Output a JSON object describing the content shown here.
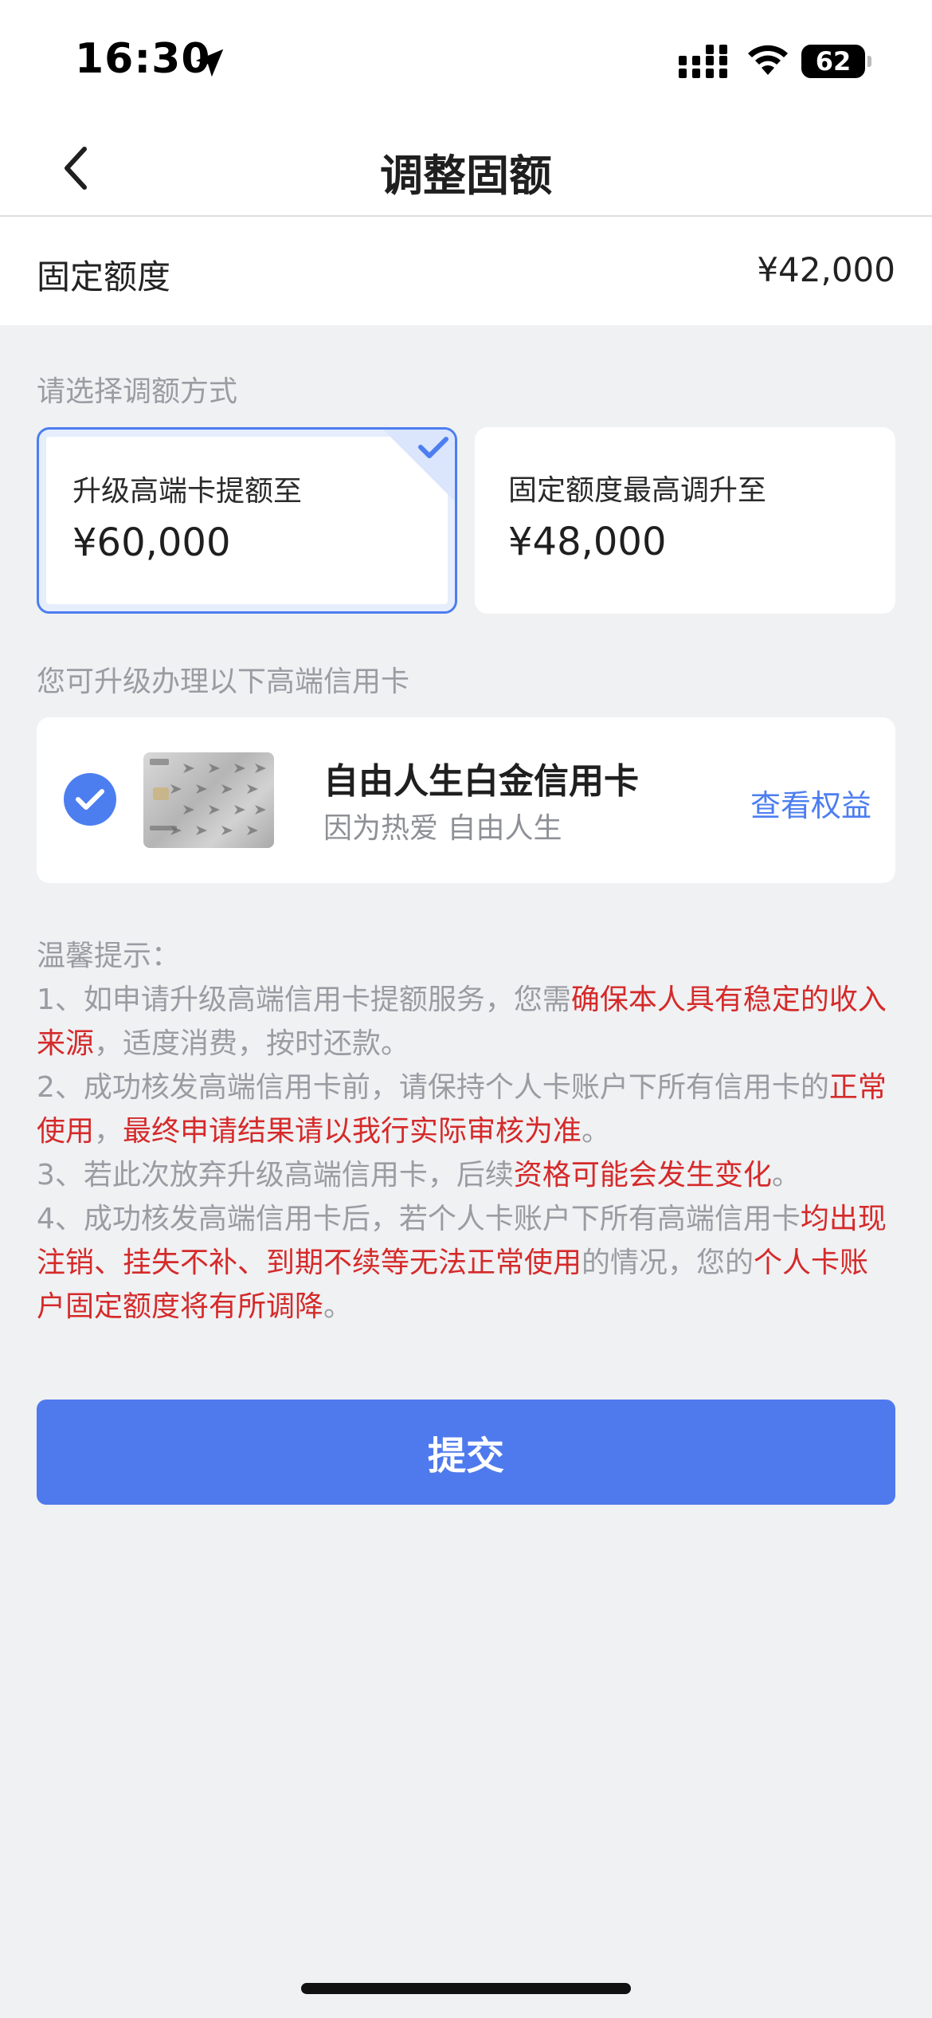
{
  "status_bar": {
    "time": "16:30",
    "battery": "62",
    "icons": [
      "location-arrow-icon",
      "signal-icon",
      "wifi-icon",
      "battery-icon"
    ]
  },
  "nav": {
    "title": "调整固额",
    "back_icon": "chevron-left-icon"
  },
  "quota": {
    "label": "固定额度",
    "value": "¥42,000"
  },
  "adjust_section": {
    "label": "请选择调额方式",
    "options": [
      {
        "title": "升级高端卡提额至",
        "value": "¥60,000",
        "selected": true
      },
      {
        "title": "固定额度最高调升至",
        "value": "¥48,000",
        "selected": false
      }
    ]
  },
  "upgrade_section": {
    "label": "您可升级办理以下高端信用卡",
    "card": {
      "name": "自由人生白金信用卡",
      "slogan": "因为热爱 自由人生",
      "link": "查看权益",
      "selected": true
    }
  },
  "tips": {
    "title": "温馨提示：",
    "items": [
      {
        "p1": "1、如申请升级高端信用卡提额服务，您需",
        "h1": "确保本人具有稳定的收入来源",
        "p2": "，适度消费，按时还款。"
      },
      {
        "p1": "2、成功核发高端信用卡前，请保持个人卡账户下所有信用卡的",
        "h1": "正常使用",
        "p2": "，",
        "h2": "最终申请结果请以我行实际审核为准",
        "p3": "。"
      },
      {
        "p1": "3、若此次放弃升级高端信用卡，后续",
        "h1": "资格可能会发生变化",
        "p2": "。"
      },
      {
        "p1": "4、成功核发高端信用卡后，若个人卡账户下所有高端信用卡",
        "h1": "均出现注销、挂失不补、到期不续等无法正常使用",
        "p2": "的情况，您的",
        "h2": "个人卡账户固定额度将有所调降",
        "p3": "。"
      }
    ]
  },
  "submit_label": "提交",
  "colors": {
    "accent": "#4f7aed",
    "highlight": "#d52a2a",
    "background": "#f0f1f3"
  }
}
